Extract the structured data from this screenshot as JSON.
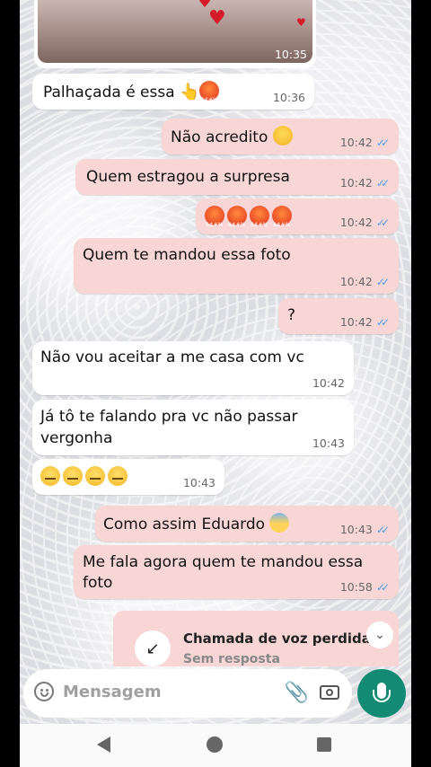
{
  "photo_message": {
    "time": "10:35"
  },
  "messages": [
    {
      "text": "Palhaçada é essa",
      "time": "10:36"
    },
    {
      "text": "Não acredito",
      "time": "10:42"
    },
    {
      "text": "Quem estragou a surpresa",
      "time": "10:42"
    },
    {
      "text": "",
      "time": "10:42"
    },
    {
      "text": "Quem te mandou essa foto",
      "time": "10:42"
    },
    {
      "text": "?",
      "time": "10:42"
    },
    {
      "text": "Não vou aceitar a me casa com vc",
      "time": "10:42"
    },
    {
      "text_line1": "Já tô te falando pra vc não passar",
      "text_line2": "vergonha",
      "time": "10:43"
    },
    {
      "text": "",
      "time": "10:43"
    },
    {
      "text": "Como assim Eduardo",
      "time": "10:43"
    },
    {
      "text_line1": "Me fala agora quem te mandou essa",
      "text_line2": "foto",
      "time": "10:58"
    }
  ],
  "missed_call": {
    "title": "Chamada de voz perdida",
    "subtitle": "Sem resposta"
  },
  "composer": {
    "placeholder": "Mensagem"
  },
  "colors": {
    "outgoing_bubble": "#f9d6d6",
    "incoming_bubble": "#ffffff",
    "read_ticks": "#4a9fe8",
    "mic_button": "#138a73"
  },
  "icons": [
    "emoji-icon",
    "attach-icon",
    "camera-icon",
    "mic-icon",
    "missed-call-icon",
    "chevron-down-icon",
    "nav-back-icon",
    "nav-home-icon",
    "nav-recents-icon"
  ]
}
